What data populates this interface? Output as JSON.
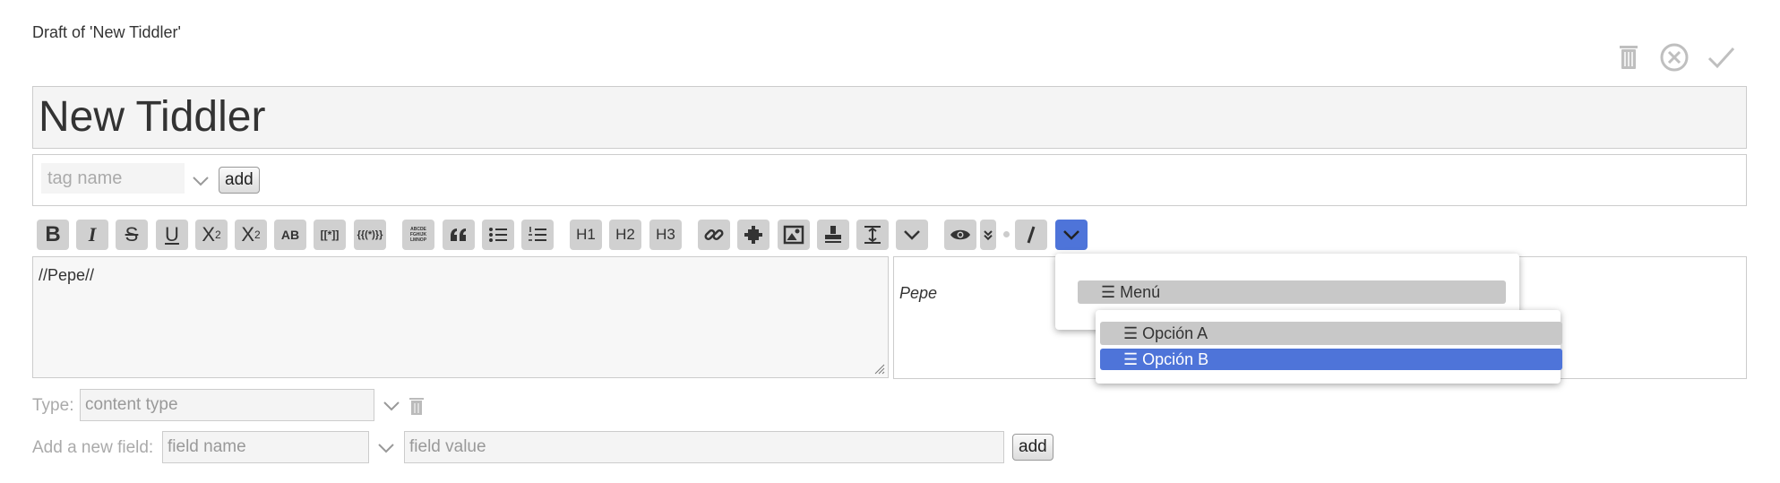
{
  "header": {
    "draft_title": "Draft of 'New Tiddler'"
  },
  "controls": {
    "delete_icon": "trash-icon",
    "cancel_icon": "circle-x-icon",
    "done_icon": "checkmark-icon"
  },
  "title": {
    "value": "New Tiddler"
  },
  "tags": {
    "placeholder": "tag name",
    "add_label": "add"
  },
  "toolbar": {
    "bold": "B",
    "italic": "I",
    "strike": "S",
    "underline": "U",
    "superscript": "X",
    "superscript_mark": "2",
    "subscript": "X",
    "subscript_mark": "2",
    "smallcaps": "AB",
    "transclude": "[[*]]",
    "macro": "{{(*)}}",
    "mono": "ABCDE FGHIJK LMNOP",
    "h1": "H1",
    "h2": "H2",
    "h3": "H3",
    "active_color": "#4e74d9",
    "button_color": "#d0d0d0"
  },
  "editor": {
    "text": "//Pepe//"
  },
  "preview": {
    "text": "Pepe"
  },
  "dropdown": {
    "menu_label": "☰ Menú",
    "submenu": [
      {
        "label": "☰ Opción A",
        "selected": false
      },
      {
        "label": "☰ Opción B",
        "selected": true
      }
    ],
    "highlight_color": "#4e74d9"
  },
  "type_row": {
    "label": "Type:",
    "placeholder": "content type"
  },
  "field_row": {
    "label": "Add a new field:",
    "name_placeholder": "field name",
    "value_placeholder": "field value",
    "add_label": "add"
  }
}
